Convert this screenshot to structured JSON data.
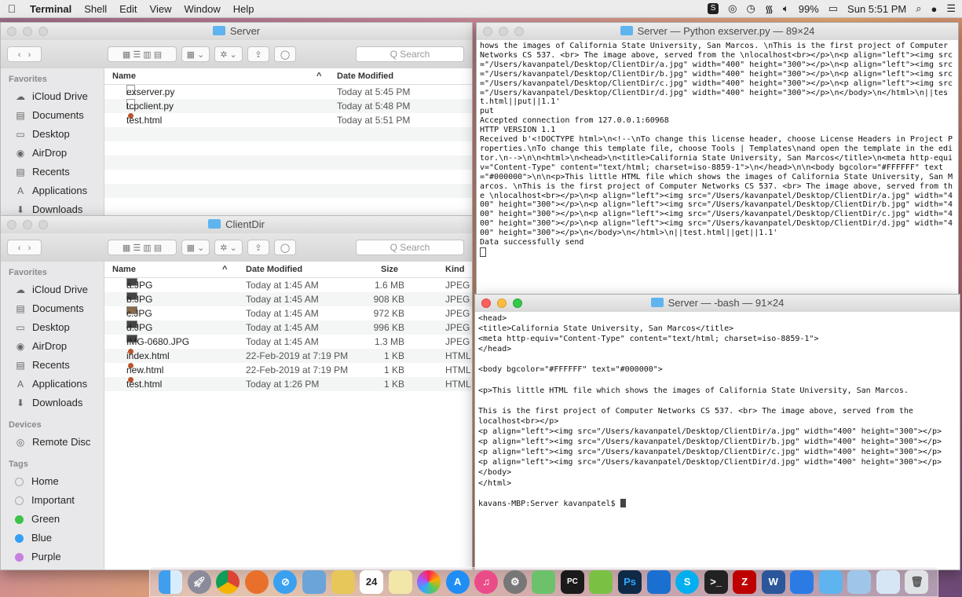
{
  "menubar": {
    "app": "Terminal",
    "items": [
      "Shell",
      "Edit",
      "View",
      "Window",
      "Help"
    ],
    "battery": "99%",
    "clock": "Sun 5:51 PM"
  },
  "server_window": {
    "title": "Server",
    "search_placeholder": "Q Search",
    "columns": {
      "name": "Name",
      "date": "Date Modified"
    },
    "files": [
      {
        "name": "exserver.py",
        "date": "Today at 5:45 PM"
      },
      {
        "name": "tcpclient.py",
        "date": "Today at 5:48 PM"
      },
      {
        "name": "test.html",
        "date": "Today at 5:51 PM"
      }
    ],
    "sidebar": {
      "favorites_label": "Favorites",
      "items": [
        "iCloud Drive",
        "Documents",
        "Desktop",
        "AirDrop",
        "Recents",
        "Applications",
        "Downloads"
      ]
    }
  },
  "client_window": {
    "title": "ClientDir",
    "search_placeholder": "Q Search",
    "columns": {
      "name": "Name",
      "date": "Date Modified",
      "size": "Size",
      "kind": "Kind"
    },
    "files": [
      {
        "name": "a.JPG",
        "date": "Today at 1:45 AM",
        "size": "1.6 MB",
        "kind": "JPEG"
      },
      {
        "name": "b.JPG",
        "date": "Today at 1:45 AM",
        "size": "908 KB",
        "kind": "JPEG"
      },
      {
        "name": "c.JPG",
        "date": "Today at 1:45 AM",
        "size": "972 KB",
        "kind": "JPEG"
      },
      {
        "name": "d.JPG",
        "date": "Today at 1:45 AM",
        "size": "996 KB",
        "kind": "JPEG"
      },
      {
        "name": "IMG-0680.JPG",
        "date": "Today at 1:45 AM",
        "size": "1.3 MB",
        "kind": "JPEG"
      },
      {
        "name": "index.html",
        "date": "22-Feb-2019 at 7:19 PM",
        "size": "1 KB",
        "kind": "HTML"
      },
      {
        "name": "new.html",
        "date": "22-Feb-2019 at 7:19 PM",
        "size": "1 KB",
        "kind": "HTML"
      },
      {
        "name": "test.html",
        "date": "Today at 1:26 PM",
        "size": "1 KB",
        "kind": "HTML"
      }
    ],
    "sidebar": {
      "favorites_label": "Favorites",
      "favorites": [
        "iCloud Drive",
        "Documents",
        "Desktop",
        "AirDrop",
        "Recents",
        "Applications",
        "Downloads"
      ],
      "devices_label": "Devices",
      "devices": [
        "Remote Disc"
      ],
      "tags_label": "Tags",
      "tags": [
        {
          "name": "Home",
          "color": "#ffffff"
        },
        {
          "name": "Important",
          "color": "#ffffff"
        },
        {
          "name": "Green",
          "color": "#3fc24a"
        },
        {
          "name": "Blue",
          "color": "#35a0f5"
        },
        {
          "name": "Purple",
          "color": "#c77fe0"
        }
      ]
    }
  },
  "terminal_python": {
    "title": "Server — Python exserver.py — 89×24",
    "text": "hows the images of California State University, San Marcos. \\nThis is the first project of Computer Networks CS 537. <br> The image above, served from the \\nlocalhost<br></p>\\n<p align=\"left\"><img src=\"/Users/kavanpatel/Desktop/ClientDir/a.jpg\" width=\"400\" height=\"300\"></p>\\n<p align=\"left\"><img src=\"/Users/kavanpatel/Desktop/ClientDir/b.jpg\" width=\"400\" height=\"300\"></p>\\n<p align=\"left\"><img src=\"/Users/kavanpatel/Desktop/ClientDir/c.jpg\" width=\"400\" height=\"300\"></p>\\n<p align=\"left\"><img src=\"/Users/kavanpatel/Desktop/ClientDir/d.jpg\" width=\"400\" height=\"300\"></p>\\n</body>\\n</html>\\n||test.html||put||1.1'\nput\nAccepted connection from 127.0.0.1:60968\nHTTP VERSION 1.1\nReceived b'<!DOCTYPE html>\\n<!--\\nTo change this license header, choose License Headers in Project Properties.\\nTo change this template file, choose Tools | Templates\\nand open the template in the editor.\\n-->\\n\\n<html>\\n<head>\\n<title>California State University, San Marcos</title>\\n<meta http-equiv=\"Content-Type\" content=\"text/html; charset=iso-8859-1\">\\n</head>\\n\\n<body bgcolor=\"#FFFFFF\" text=\"#000000\">\\n\\n<p>This little HTML file which shows the images of California State University, San Marcos. \\nThis is the first project of Computer Networks CS 537. <br> The image above, served from the \\nlocalhost<br></p>\\n<p align=\"left\"><img src=\"/Users/kavanpatel/Desktop/ClientDir/a.jpg\" width=\"400\" height=\"300\"></p>\\n<p align=\"left\"><img src=\"/Users/kavanpatel/Desktop/ClientDir/b.jpg\" width=\"400\" height=\"300\"></p>\\n<p align=\"left\"><img src=\"/Users/kavanpatel/Desktop/ClientDir/c.jpg\" width=\"400\" height=\"300\"></p>\\n<p align=\"left\"><img src=\"/Users/kavanpatel/Desktop/ClientDir/d.jpg\" width=\"400\" height=\"300\"></p>\\n</body>\\n</html>\\n||test.html||get||1.1'\nData successfully send"
  },
  "terminal_bash": {
    "title": "Server — -bash — 91×24",
    "text": "<head>\n<title>California State University, San Marcos</title>\n<meta http-equiv=\"Content-Type\" content=\"text/html; charset=iso-8859-1\">\n</head>\n\n<body bgcolor=\"#FFFFFF\" text=\"#000000\">\n\n<p>This little HTML file which shows the images of California State University, San Marcos.\n\nThis is the first project of Computer Networks CS 537. <br> The image above, served from the\nlocalhost<br></p>\n<p align=\"left\"><img src=\"/Users/kavanpatel/Desktop/ClientDir/a.jpg\" width=\"400\" height=\"300\"></p>\n<p align=\"left\"><img src=\"/Users/kavanpatel/Desktop/ClientDir/b.jpg\" width=\"400\" height=\"300\"></p>\n<p align=\"left\"><img src=\"/Users/kavanpatel/Desktop/ClientDir/c.jpg\" width=\"400\" height=\"300\"></p>\n<p align=\"left\"><img src=\"/Users/kavanpatel/Desktop/ClientDir/d.jpg\" width=\"400\" height=\"300\"></p>\n</body>\n</html>\n",
    "prompt": "kavans-MBP:Server kavanpatel$ "
  },
  "dock": {
    "calendar_day": "24"
  }
}
